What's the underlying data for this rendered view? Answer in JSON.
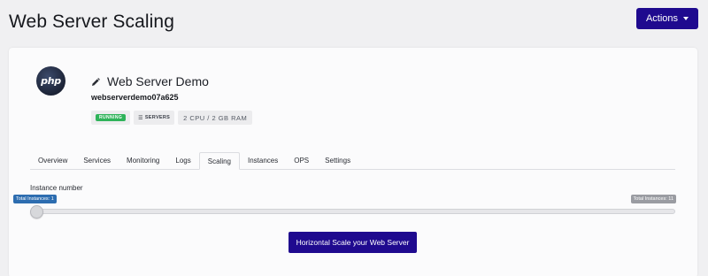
{
  "page": {
    "title": "Web Server Scaling"
  },
  "header": {
    "actions_label": "Actions"
  },
  "app": {
    "logo_text": "php",
    "name": "Web Server Demo",
    "id": "webserverdemo07a625",
    "status": "RUNNING",
    "type_label": "SERVERS",
    "specs": "2 CPU / 2 GB RAM",
    "colors": {
      "status_running": "#2fb35a",
      "primary": "#1f0a8f"
    }
  },
  "tabs": [
    {
      "label": "Overview",
      "active": false
    },
    {
      "label": "Services",
      "active": false
    },
    {
      "label": "Monitoring",
      "active": false
    },
    {
      "label": "Logs",
      "active": false
    },
    {
      "label": "Scaling",
      "active": true
    },
    {
      "label": "Instances",
      "active": false
    },
    {
      "label": "OPS",
      "active": false
    },
    {
      "label": "Settings",
      "active": false
    }
  ],
  "scaling": {
    "label": "Instance number",
    "min_label": "Total Instances: 1",
    "max_label": "Total Instances: 11",
    "min": 1,
    "max": 11,
    "value": 1,
    "button_label": "Horizontal Scale your Web Server"
  }
}
